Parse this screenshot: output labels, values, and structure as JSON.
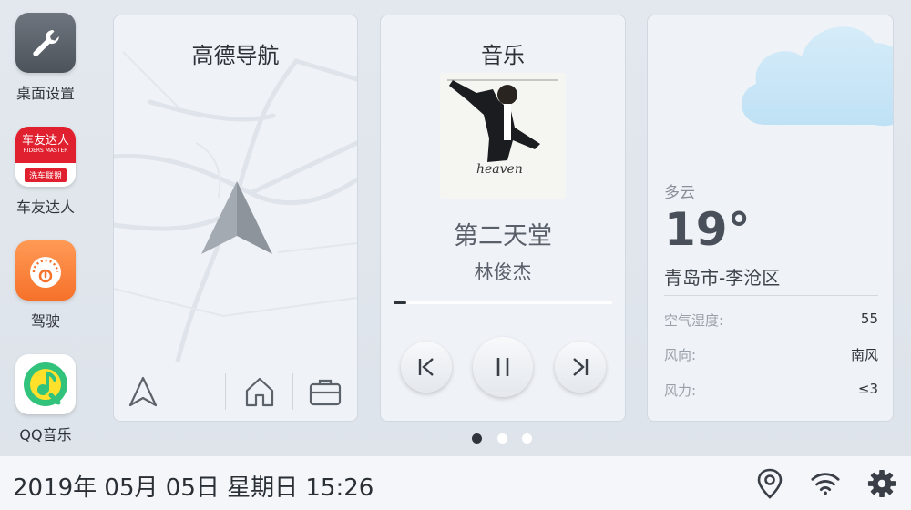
{
  "dock": {
    "apps": [
      {
        "label": "桌面设置",
        "icon": "wrench-icon"
      },
      {
        "label": "车友达人",
        "icon": "riders-master-logo",
        "logo_top": "车友达人",
        "logo_sub": "RIDERS MASTER",
        "logo_bottom": "洗车联盟"
      },
      {
        "label": "驾驶",
        "icon": "speedometer-icon"
      },
      {
        "label": "QQ音乐",
        "icon": "qq-music-icon"
      }
    ]
  },
  "nav": {
    "title": "高德导航",
    "bottom_buttons": [
      "navigate-icon",
      "home-icon",
      "briefcase-icon"
    ]
  },
  "music": {
    "title": "音乐",
    "song": "第二天堂",
    "artist": "林俊杰",
    "progress": 0.06,
    "album_text": "heaven"
  },
  "weather": {
    "condition": "多云",
    "temperature": "19°",
    "city": "青岛市-李沧区",
    "rows": [
      {
        "key": "空气湿度:",
        "value": "55"
      },
      {
        "key": "风向:",
        "value": "南风"
      },
      {
        "key": "风力:",
        "value": "≤3"
      }
    ]
  },
  "pager": {
    "count": 3,
    "active": 0
  },
  "statusbar": {
    "datetime": "2019年 05月 05日 星期日 15:26",
    "icons": [
      "location-icon",
      "wifi-icon",
      "settings-gear-icon"
    ]
  },
  "colors": {
    "accent_orange": "#f6712a",
    "riders_red": "#e0202e",
    "qq_green": "#31c27c",
    "qq_yellow": "#ffe12b"
  }
}
